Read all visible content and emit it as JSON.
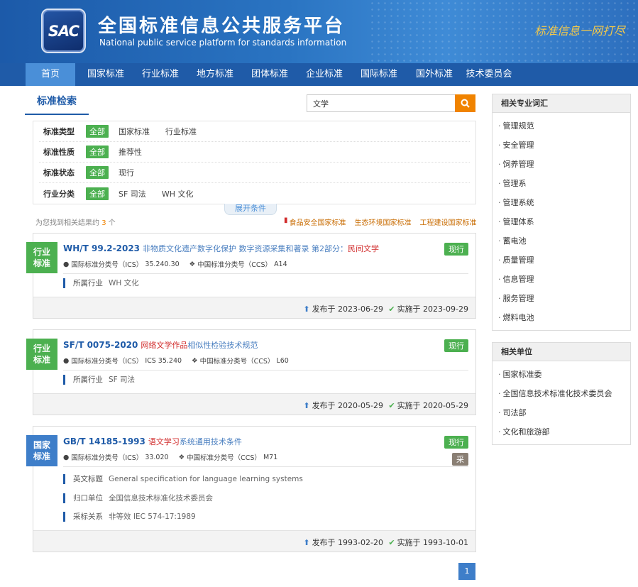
{
  "header": {
    "logo_text": "SAC",
    "title": "全国标准信息公共服务平台",
    "subtitle": "National public service platform  for standards information",
    "slogan": "标准信息一网打尽"
  },
  "nav": {
    "items": [
      "首页",
      "国家标准",
      "行业标准",
      "地方标准",
      "团体标准",
      "企业标准",
      "国际标准",
      "国外标准",
      "技术委员会"
    ]
  },
  "search": {
    "tab_label": "标准检索",
    "query": "文学"
  },
  "filters": {
    "rows": [
      {
        "label": "标准类型",
        "all": "全部",
        "options": [
          "国家标准",
          "行业标准"
        ]
      },
      {
        "label": "标准性质",
        "all": "全部",
        "options": [
          "推荐性"
        ]
      },
      {
        "label": "标准状态",
        "all": "全部",
        "options": [
          "现行"
        ]
      },
      {
        "label": "行业分类",
        "all": "全部",
        "options": [
          "SF 司法",
          "WH 文化"
        ]
      }
    ],
    "expand_label": "展开条件"
  },
  "results_info": {
    "prefix": "为您找到相关结果约",
    "count": "3",
    "suffix": "个"
  },
  "quick_links": [
    "食品安全国家标准",
    "生态环境国家标准",
    "工程建设国家标准"
  ],
  "results": [
    {
      "badge": "行业标准",
      "code": "WH/T 99.2-2023",
      "title_pre": "非物质文化遗产数字化保护 数字资源采集和著录 第2部分：",
      "title_hl": "民间文学",
      "title_post": "",
      "status": "现行",
      "ics_label": "国际标准分类号（ICS）",
      "ics": "35.240.30",
      "ccs_label": "中国标准分类号（CCS）",
      "ccs": "A14",
      "attr_label": "所属行业",
      "attr_value": "WH 文化",
      "publish": "发布于 2023-06-29",
      "implement": "实施于 2023-09-29"
    },
    {
      "badge": "行业标准",
      "code": "SF/T 0075-2020",
      "title_pre": "",
      "title_hl": "网络文学作品",
      "title_post": "相似性检验技术规范",
      "status": "现行",
      "ics_label": "国际标准分类号（ICS）",
      "ics": "ICS 35.240",
      "ccs_label": "中国标准分类号（CCS）",
      "ccs": "L60",
      "attr_label": "所属行业",
      "attr_value": "SF 司法",
      "publish": "发布于 2020-05-29",
      "implement": "实施于 2020-05-29"
    },
    {
      "badge": "国家标准",
      "code": "GB/T 14185-1993",
      "title_pre": "",
      "title_hl": "语文学习",
      "title_post": "系统通用技术条件",
      "status": "现行",
      "adopt": "采",
      "ics_label": "国际标准分类号（ICS）",
      "ics": "33.020",
      "ccs_label": "中国标准分类号（CCS）",
      "ccs": "M71",
      "attrs": [
        {
          "label": "英文标题",
          "value": "General specification for language learning systems"
        },
        {
          "label": "归口单位",
          "value": "全国信息技术标准化技术委员会"
        },
        {
          "label": "采标关系",
          "value": "非等效  IEC 574-17:1989"
        }
      ],
      "publish": "发布于 1993-02-20",
      "implement": "实施于 1993-10-01"
    }
  ],
  "pager": {
    "current": "1"
  },
  "sidebar": {
    "terms_title": "相关专业词汇",
    "terms": [
      "管理规范",
      "安全管理",
      "饲养管理",
      "管理系",
      "管理系统",
      "管理体系",
      "蓄电池",
      "质量管理",
      "信息管理",
      "服务管理",
      "燃料电池"
    ],
    "units_title": "相关单位",
    "units": [
      "国家标准委",
      "全国信息技术标准化技术委员会",
      "司法部",
      "文化和旅游部"
    ]
  },
  "colors": {
    "nav_bg": "#1f5ba8",
    "nav_active": "#4a8fd8",
    "accent_orange": "#f08300",
    "status_green": "#4cb050",
    "highlight_red": "#d12b2b"
  }
}
